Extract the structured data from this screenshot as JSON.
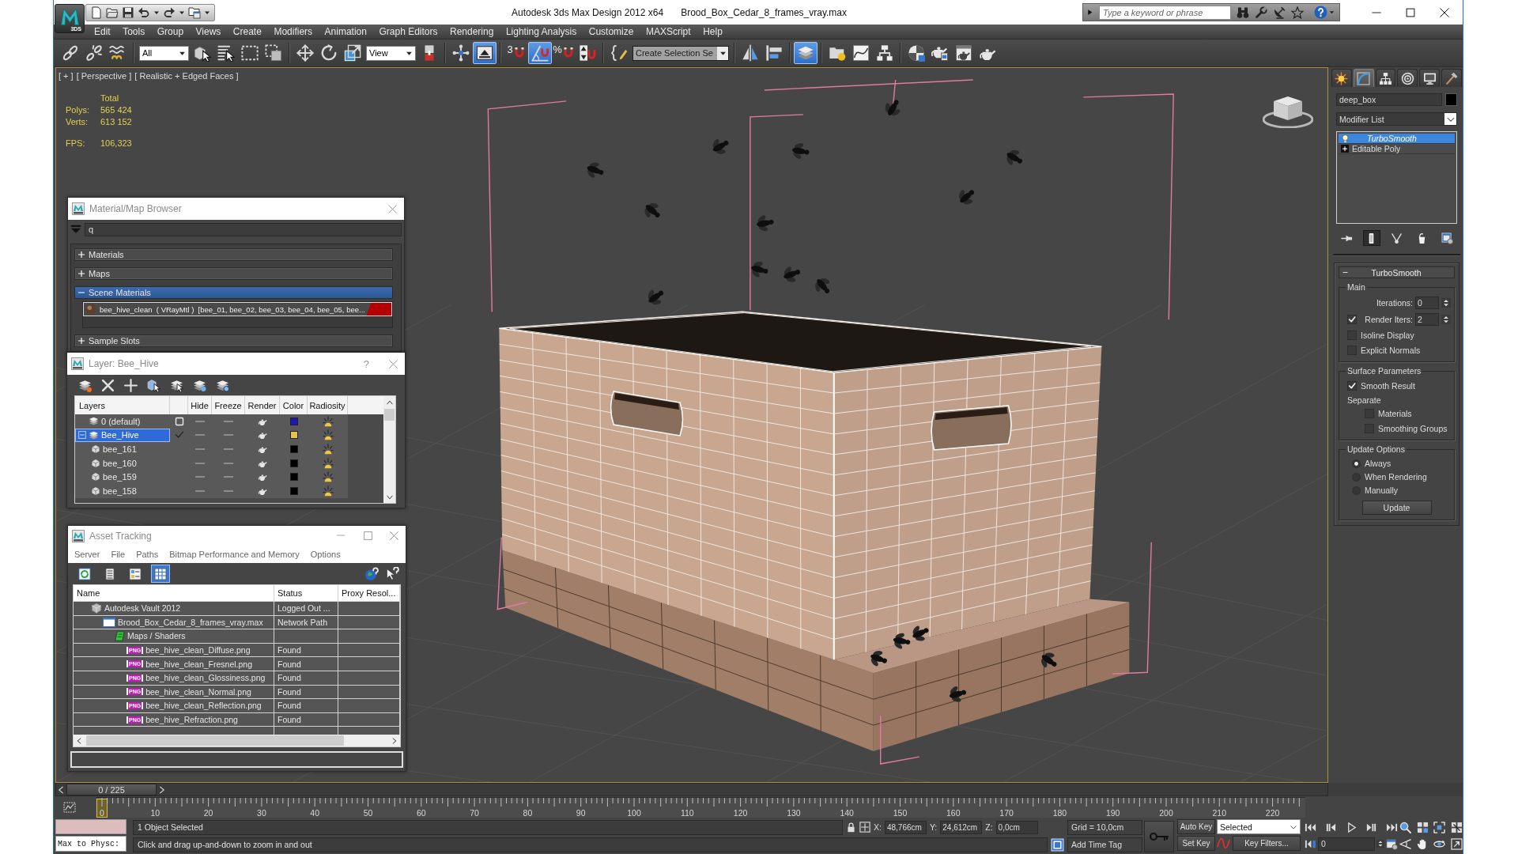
{
  "title_bar": {
    "app_badge": "3DS",
    "app_title": "Autodesk 3ds Max Design 2012 x64",
    "file_name": "Brood_Box_Cedar_8_frames_vray.max",
    "search": {
      "placeholder": "Type a keyword or phrase"
    }
  },
  "menu": [
    "Edit",
    "Tools",
    "Group",
    "Views",
    "Create",
    "Modifiers",
    "Animation",
    "Graph Editors",
    "Rendering",
    "Lighting Analysis",
    "Customize",
    "MAXScript",
    "Help"
  ],
  "toolbar": [
    {
      "kind": "tool",
      "pressed": false
    },
    {
      "kind": "tool",
      "pressed": false
    },
    {
      "kind": "tool",
      "pressed": false
    },
    {
      "kind": "separator"
    },
    {
      "kind": "dropdown",
      "value": "All"
    },
    {
      "kind": "tool",
      "pressed": false
    },
    {
      "kind": "tool",
      "pressed": false
    },
    {
      "kind": "tool",
      "pressed": false
    },
    {
      "kind": "tool",
      "pressed": false
    },
    {
      "kind": "separator"
    },
    {
      "kind": "tool",
      "pressed": false
    },
    {
      "kind": "tool",
      "pressed": false
    },
    {
      "kind": "tool",
      "pressed": false
    },
    {
      "kind": "dropdown",
      "value": "View"
    },
    {
      "kind": "tool",
      "pressed": false
    },
    {
      "kind": "separator"
    },
    {
      "kind": "tool",
      "pressed": false
    },
    {
      "kind": "tool",
      "pressed": true
    },
    {
      "kind": "separator"
    },
    {
      "kind": "tool",
      "label": "3",
      "pressed": false
    },
    {
      "kind": "tool",
      "pressed": true
    },
    {
      "kind": "tool",
      "label": "%",
      "pressed": false
    },
    {
      "kind": "tool",
      "pressed": false
    },
    {
      "kind": "separator"
    },
    {
      "kind": "tool",
      "pressed": false
    },
    {
      "kind": "combo",
      "value": "Create Selection Se"
    },
    {
      "kind": "separator"
    },
    {
      "kind": "tool",
      "pressed": false
    },
    {
      "kind": "tool",
      "pressed": false
    },
    {
      "kind": "separator"
    },
    {
      "kind": "tool",
      "pressed": true
    },
    {
      "kind": "separator"
    },
    {
      "kind": "tool",
      "pressed": false
    },
    {
      "kind": "tool",
      "pressed": false
    },
    {
      "kind": "tool",
      "pressed": false
    },
    {
      "kind": "separator"
    },
    {
      "kind": "tool",
      "pressed": false
    },
    {
      "kind": "tool",
      "pressed": false
    },
    {
      "kind": "tool",
      "pressed": false
    },
    {
      "kind": "tool",
      "pressed": false
    }
  ],
  "viewport": {
    "labels": [
      "[ + ]",
      "[ Perspective ]",
      "[ Realistic + Edged Faces ]"
    ],
    "stats_heading": "Total",
    "stats": [
      {
        "kind": "count",
        "label": "Polys:",
        "value": "565 424"
      },
      {
        "kind": "count",
        "label": "Verts:",
        "value": "613 152"
      },
      {
        "kind": "rate",
        "label": "FPS:",
        "value": "106,323"
      }
    ]
  },
  "material_browser": {
    "title": "Material/Map Browser",
    "search_value": "q",
    "sections": [
      {
        "label": "Materials",
        "expanded": false,
        "selected": false
      },
      {
        "label": "Maps",
        "expanded": false,
        "selected": false
      },
      {
        "label": "Scene Materials",
        "expanded": true,
        "selected": true,
        "items": [
          {
            "text": "bee_hive_clean  ( VRayMtl )  [bee_01, bee_02, bee_03, bee_04, bee_05, bee..."
          }
        ]
      },
      {
        "label": "Sample Slots",
        "expanded": false,
        "selected": false
      }
    ]
  },
  "layer_manager": {
    "title": "Layer: Bee_Hive",
    "help": "?",
    "columns": [
      "Layers",
      "Hide",
      "Freeze",
      "Render",
      "Color",
      "Radiosity"
    ],
    "layers": [
      {
        "kind": "layer",
        "name": "0 (default)",
        "current": false,
        "selected": false,
        "color": "#1a1ab4"
      },
      {
        "kind": "layer",
        "name": "Bee_Hive",
        "current": true,
        "selected": true,
        "expanded": true,
        "color": "#e3c34c",
        "children": [
          {
            "kind": "object",
            "name": "bee_161",
            "selected": false,
            "color": "#000000"
          },
          {
            "kind": "object",
            "name": "bee_160",
            "selected": false,
            "color": "#000000"
          },
          {
            "kind": "object",
            "name": "bee_159",
            "selected": false,
            "color": "#000000"
          },
          {
            "kind": "object",
            "name": "bee_158",
            "selected": false,
            "color": "#000000"
          }
        ]
      }
    ]
  },
  "asset_tracking": {
    "title": "Asset Tracking",
    "menu": [
      "Server",
      "File",
      "Paths",
      "Bitmap Performance and Memory",
      "Options"
    ],
    "views": [
      {
        "selected": false
      },
      {
        "selected": false
      },
      {
        "selected": false
      },
      {
        "selected": true
      }
    ],
    "columns": [
      "Name",
      "Status",
      "Proxy Resol..."
    ],
    "assets": [
      {
        "kind": "vault",
        "name": "Autodesk Vault 2012",
        "status": "Logged Out ...",
        "children": [
          {
            "kind": "scene",
            "name": "Brood_Box_Cedar_8_frames_vray.max",
            "status": "Network Path",
            "children": [
              {
                "kind": "folder",
                "name": "Maps / Shaders",
                "children": [
                  {
                    "kind": "image",
                    "file_type": "PNG",
                    "name": "bee_hive_clean_Diffuse.png",
                    "status": "Found"
                  },
                  {
                    "kind": "image",
                    "file_type": "PNG",
                    "name": "bee_hive_clean_Fresnel.png",
                    "status": "Found"
                  },
                  {
                    "kind": "image",
                    "file_type": "PNG",
                    "name": "bee_hive_clean_Glossiness.png",
                    "status": "Found"
                  },
                  {
                    "kind": "image",
                    "file_type": "PNG",
                    "name": "bee_hive_clean_Normal.png",
                    "status": "Found"
                  },
                  {
                    "kind": "image",
                    "file_type": "PNG",
                    "name": "bee_hive_clean_Reflection.png",
                    "status": "Found"
                  },
                  {
                    "kind": "image",
                    "file_type": "PNG",
                    "name": "bee_hive_Refraction.png",
                    "status": "Found"
                  }
                ]
              }
            ]
          }
        ]
      }
    ]
  },
  "command_panel": {
    "tabs": [
      {
        "selected": false
      },
      {
        "selected": true
      },
      {
        "selected": false
      },
      {
        "selected": false
      },
      {
        "selected": false
      },
      {
        "selected": false
      }
    ],
    "object_name": "deep_box",
    "modifier_dropdown": "Modifier List",
    "stack": [
      {
        "kind": "modifier",
        "name": "TurboSmooth",
        "on": true,
        "selected": true
      },
      {
        "kind": "object",
        "name": "Editable Poly",
        "expanded": false,
        "selected": false
      }
    ],
    "stack_tools": [
      {
        "pressed": false
      },
      {
        "pressed": true
      },
      {
        "pressed": false
      },
      {
        "pressed": false
      },
      {
        "pressed": false
      }
    ],
    "rollout": {
      "title": "TurboSmooth",
      "expanded": true,
      "groups": [
        {
          "title": "Main",
          "controls": [
            {
              "kind": "spinner",
              "label": "Iterations:",
              "value": "0"
            },
            {
              "kind": "spinner",
              "label": "Render Iters:",
              "value": "2",
              "checked": true
            },
            {
              "kind": "checkbox",
              "label": "Isoline Display",
              "checked": false
            },
            {
              "kind": "checkbox",
              "label": "Explicit Normals",
              "checked": false
            }
          ]
        },
        {
          "title": "Surface Parameters",
          "controls": [
            {
              "kind": "checkbox",
              "label": "Smooth Result",
              "checked": true
            },
            {
              "kind": "label",
              "label": "Separate",
              "children": [
                {
                  "kind": "checkbox",
                  "label": "Materials",
                  "checked": false
                },
                {
                  "kind": "checkbox",
                  "label": "Smoothing Groups",
                  "checked": false
                }
              ]
            }
          ]
        },
        {
          "title": "Update Options",
          "controls": [
            {
              "kind": "radio",
              "label": "Always",
              "selected": true
            },
            {
              "kind": "radio",
              "label": "When Rendering",
              "selected": false
            },
            {
              "kind": "radio",
              "label": "Manually",
              "selected": false
            },
            {
              "kind": "button",
              "label": "Update"
            }
          ]
        }
      ]
    }
  },
  "time_slider": {
    "position": "0 / 225",
    "level": 0
  },
  "track_bar": {
    "ticks": [
      "0",
      "10",
      "20",
      "30",
      "40",
      "50",
      "60",
      "70",
      "80",
      "90",
      "100",
      "110",
      "120",
      "130",
      "140",
      "150",
      "160",
      "170",
      "180",
      "190",
      "200",
      "210",
      "220"
    ]
  },
  "status_bar": {
    "script_output": "Max to Physc:",
    "prompts": [
      "1 Object Selected",
      "Click and drag up-and-down to zoom in and out"
    ],
    "coordinates": [
      {
        "axis": "X:",
        "value": "48,766cm"
      },
      {
        "axis": "Y:",
        "value": "24,612cm"
      },
      {
        "axis": "Z:",
        "value": "0,0cm"
      }
    ],
    "grid": "Grid = 10,0cm",
    "time_tag": "Add Time Tag",
    "auto_key": "Auto Key",
    "key_set": "Selected",
    "set_key": "Set Key",
    "key_filters": "Key Filters...",
    "frame": "0"
  }
}
